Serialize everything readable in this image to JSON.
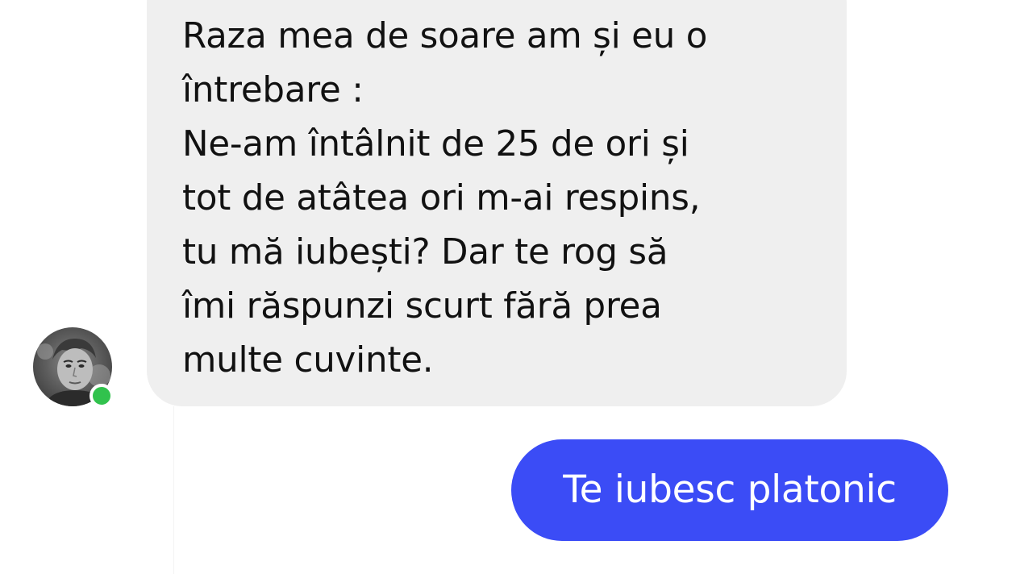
{
  "conversation": {
    "incoming_message": {
      "text": "Raza mea de soare am și eu o\nîntrebare :\nNe-am întâlnit de 25 de ori și\ntot de atâtea ori m-ai respins,\ntu mă iubești? Dar te rog să\nîmi răspunzi scurt fără prea\nmulte cuvinte.",
      "sender_status": "online"
    },
    "outgoing_message": {
      "text": "Te iubesc platonic"
    }
  },
  "colors": {
    "incoming_bubble": "#efefef",
    "outgoing_bubble": "#3b4cf6",
    "online_indicator": "#31c24d",
    "text_dark": "#111111",
    "text_light": "#ffffff"
  },
  "icons": {
    "avatar": "contact-avatar",
    "status": "online-status-dot"
  }
}
